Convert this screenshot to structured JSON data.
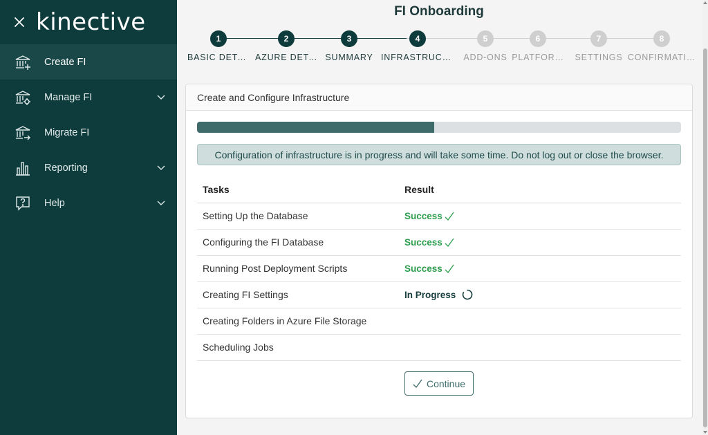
{
  "sidebar": {
    "logo": "kinective",
    "close_icon": "close-icon",
    "items": [
      {
        "label": "Create FI",
        "icon": "bank-plus-icon",
        "active": true,
        "expandable": false
      },
      {
        "label": "Manage FI",
        "icon": "bank-gear-icon",
        "active": false,
        "expandable": true
      },
      {
        "label": "Migrate FI",
        "icon": "bank-arrow-icon",
        "active": false,
        "expandable": false
      },
      {
        "label": "Reporting",
        "icon": "bar-chart-icon",
        "active": false,
        "expandable": true
      },
      {
        "label": "Help",
        "icon": "help-icon",
        "active": false,
        "expandable": true
      }
    ]
  },
  "page": {
    "title": "FI Onboarding"
  },
  "stepper": {
    "steps": [
      {
        "number": "1",
        "label": "BASIC DETA…",
        "state": "complete"
      },
      {
        "number": "2",
        "label": "AZURE DETA…",
        "state": "complete"
      },
      {
        "number": "3",
        "label": "SUMMARY",
        "state": "complete"
      },
      {
        "number": "4",
        "label": "INFRASTRUCT…",
        "state": "current"
      },
      {
        "number": "5",
        "label": "ADD-ONS",
        "state": "inactive"
      },
      {
        "number": "6",
        "label": "PLATFOR…",
        "state": "inactive"
      },
      {
        "number": "7",
        "label": "SETTINGS",
        "state": "inactive"
      },
      {
        "number": "8",
        "label": "CONFIRMATI…",
        "state": "inactive"
      }
    ]
  },
  "card": {
    "header": "Create and Configure Infrastructure",
    "progress_fraction": 0.49,
    "alert": "Configuration of infrastructure is in progress and will take some time. Do not log out or close the browser.",
    "table": {
      "headers": [
        "Tasks",
        "Result"
      ],
      "rows": [
        {
          "task": "Setting Up the Database",
          "result": "Success",
          "status": "success"
        },
        {
          "task": "Configuring the FI Database",
          "result": "Success",
          "status": "success"
        },
        {
          "task": "Running Post Deployment Scripts",
          "result": "Success",
          "status": "success"
        },
        {
          "task": "Creating FI Settings",
          "result": "In Progress",
          "status": "progress"
        },
        {
          "task": "Creating Folders in Azure File Storage",
          "result": "",
          "status": "none"
        },
        {
          "task": "Scheduling Jobs",
          "result": "",
          "status": "none"
        }
      ]
    },
    "continue_label": "Continue"
  },
  "colors": {
    "sidebar_bg": "#0e3b3b",
    "sidebar_active": "#1a4848",
    "accent": "#3f6b6b",
    "success": "#2e9e4e",
    "inactive_step": "#cfcfcf"
  }
}
